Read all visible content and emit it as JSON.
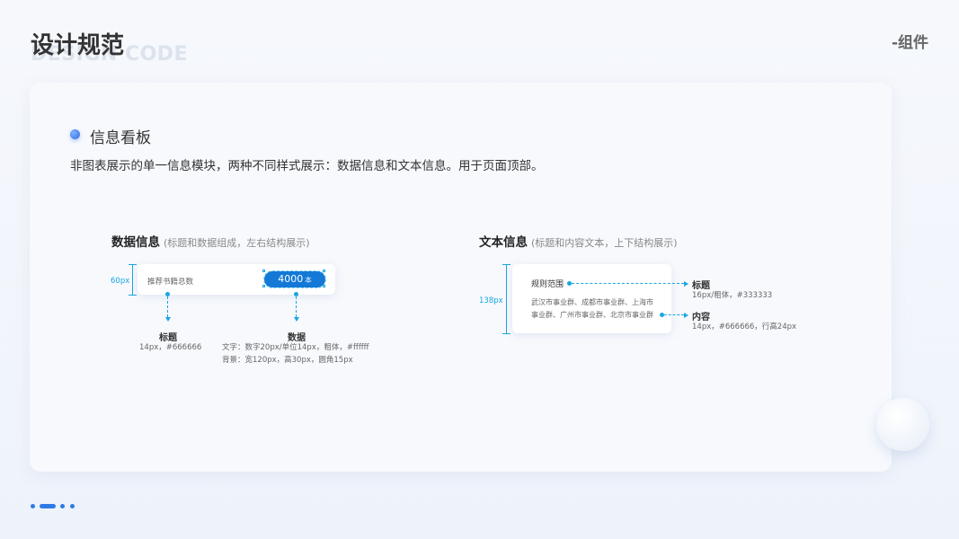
{
  "header": {
    "title": "设计规范",
    "title_en": "DESIGN CODE",
    "section_tag": "-组件"
  },
  "section": {
    "heading": "信息看板",
    "description": "非图表展示的单一信息模块，两种不同样式展示：数据信息和文本信息。用于页面顶部。"
  },
  "data_info": {
    "title": "数据信息",
    "note": "(标题和数据组成，左右结构展示)",
    "height_label": "60px",
    "card_label": "推荐书籍总数",
    "value": "4000",
    "unit": "本",
    "title_anno": {
      "title": "标题",
      "spec": "14px，#666666"
    },
    "data_anno": {
      "title": "数据",
      "spec_text": "文字：数字20px/单位14px，粗体，#ffffff",
      "spec_bg": "背景：宽120px，高30px，圆角15px"
    }
  },
  "text_info": {
    "title": "文本信息",
    "note": "(标题和内容文本，上下结构展示)",
    "height_label": "138px",
    "card_title": "规则范围",
    "card_body": "武汉市事业群、成都市事业群、上海市事业群、广州市事业群、北京市事业群",
    "title_anno": {
      "title": "标题",
      "spec": "16px/粗体，#333333"
    },
    "content_anno": {
      "title": "内容",
      "spec": "14px，#666666，行高24px"
    }
  },
  "colors": {
    "accent": "#1479d6",
    "annotation": "#1aa6e0",
    "title_text": "#333333",
    "body_text": "#666666"
  },
  "pager": {
    "count": 4,
    "active_index": 1
  }
}
